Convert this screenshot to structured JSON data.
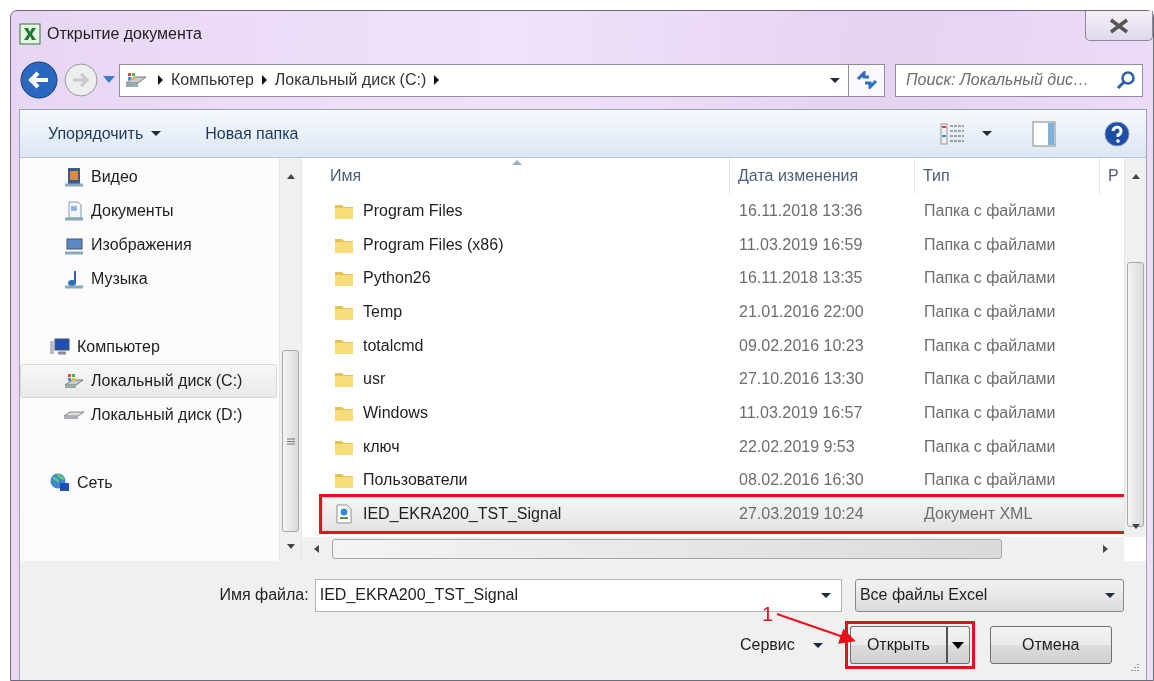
{
  "window": {
    "title": "Открытие документа"
  },
  "address": {
    "segments": [
      "Компьютер",
      "Локальный диск (C:)"
    ]
  },
  "search": {
    "placeholder": "Поиск: Локальный дис…"
  },
  "toolbar": {
    "buttons": [
      {
        "label": "Упорядочить",
        "dropdown": true
      },
      {
        "label": "Новая папка",
        "dropdown": false
      }
    ]
  },
  "sidebar": {
    "groups": [
      {
        "children": [
          {
            "label": "Видео",
            "kind": "video",
            "selected": false
          },
          {
            "label": "Документы",
            "kind": "documents",
            "selected": false
          },
          {
            "label": "Изображения",
            "kind": "images",
            "selected": false
          },
          {
            "label": "Музыка",
            "kind": "music",
            "selected": false
          }
        ]
      },
      {
        "label": "Компьютер",
        "kind": "computer",
        "selected": false,
        "children": [
          {
            "label": "Локальный диск (C:)",
            "kind": "system-drive",
            "selected": true
          },
          {
            "label": "Локальный диск (D:)",
            "kind": "drive",
            "selected": false
          }
        ]
      },
      {
        "label": "Сеть",
        "kind": "network",
        "selected": false
      }
    ]
  },
  "table": {
    "columns": [
      {
        "label": "Имя",
        "sorted": true
      },
      {
        "label": "Дата изменения",
        "sorted": false
      },
      {
        "label": "Тип",
        "sorted": false
      },
      {
        "label": "Р",
        "sorted": false
      }
    ],
    "rows": [
      {
        "name": "Program Files",
        "date": "16.11.2018 13:36",
        "type": "Папка с файлами",
        "kind": "folder",
        "selected": false,
        "highlighted": false
      },
      {
        "name": "Program Files (x86)",
        "date": "11.03.2019 16:59",
        "type": "Папка с файлами",
        "kind": "folder",
        "selected": false,
        "highlighted": false
      },
      {
        "name": "Python26",
        "date": "16.11.2018 13:35",
        "type": "Папка с файлами",
        "kind": "folder",
        "selected": false,
        "highlighted": false
      },
      {
        "name": "Temp",
        "date": "21.01.2016 22:00",
        "type": "Папка с файлами",
        "kind": "folder",
        "selected": false,
        "highlighted": false
      },
      {
        "name": "totalcmd",
        "date": "09.02.2016 10:23",
        "type": "Папка с файлами",
        "kind": "folder",
        "selected": false,
        "highlighted": false
      },
      {
        "name": "usr",
        "date": "27.10.2016 13:30",
        "type": "Папка с файлами",
        "kind": "folder",
        "selected": false,
        "highlighted": false
      },
      {
        "name": "Windows",
        "date": "11.03.2019 16:57",
        "type": "Папка с файлами",
        "kind": "folder",
        "selected": false,
        "highlighted": false
      },
      {
        "name": "ключ",
        "date": "22.02.2019 9:53",
        "type": "Папка с файлами",
        "kind": "folder",
        "selected": false,
        "highlighted": false
      },
      {
        "name": "Пользователи",
        "date": "08.02.2016 16:30",
        "type": "Папка с файлами",
        "kind": "folder",
        "selected": false,
        "highlighted": false
      },
      {
        "name": "IED_EKRA200_TST_Signal",
        "date": "27.03.2019 10:24",
        "type": "Документ XML",
        "kind": "xml",
        "selected": true,
        "highlighted": true
      }
    ]
  },
  "bottom": {
    "filename_label": "Имя файла:",
    "filename_value": "IED_EKRA200_TST_Signal",
    "filter": "Все файлы Excel",
    "tools": "Сервис",
    "open_button": {
      "label": "Открыть",
      "highlighted": true
    },
    "cancel_button": "Отмена"
  },
  "annotation": {
    "label": "1"
  }
}
